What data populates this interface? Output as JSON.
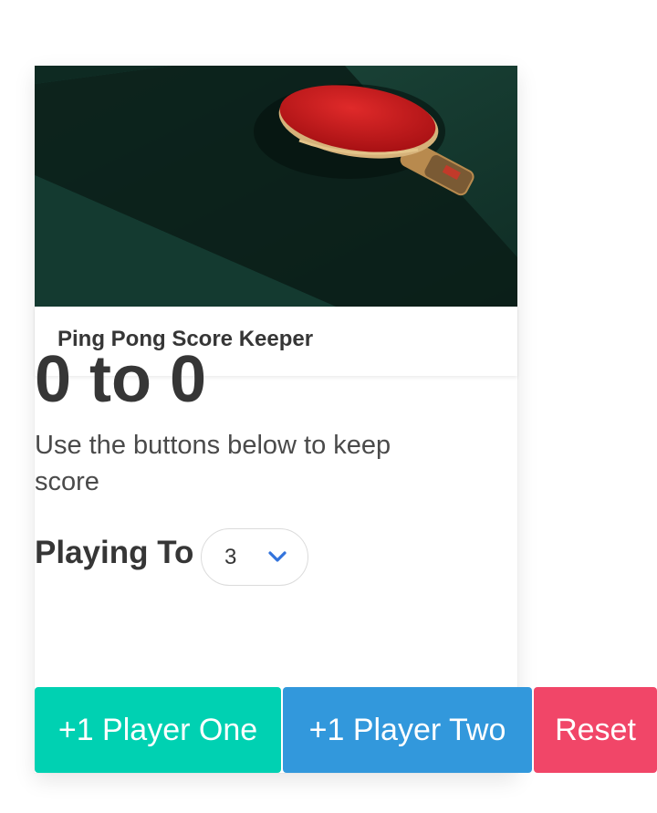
{
  "card": {
    "title": "Ping Pong Score Keeper",
    "image_alt": "ping-pong-paddle-photo"
  },
  "score": {
    "text": "0 to 0",
    "player_one": 0,
    "player_two": 0
  },
  "description": "Use the buttons below to keep score",
  "playing_to": {
    "label": "Playing To",
    "selected": "3"
  },
  "buttons": {
    "player_one": "+1 Player One",
    "player_two": "+1 Player Two",
    "reset": "Reset"
  },
  "colors": {
    "primary": "#00d1b2",
    "info": "#3298dc",
    "danger": "#f14668",
    "text": "#363636",
    "chevron": "#3273dc"
  }
}
